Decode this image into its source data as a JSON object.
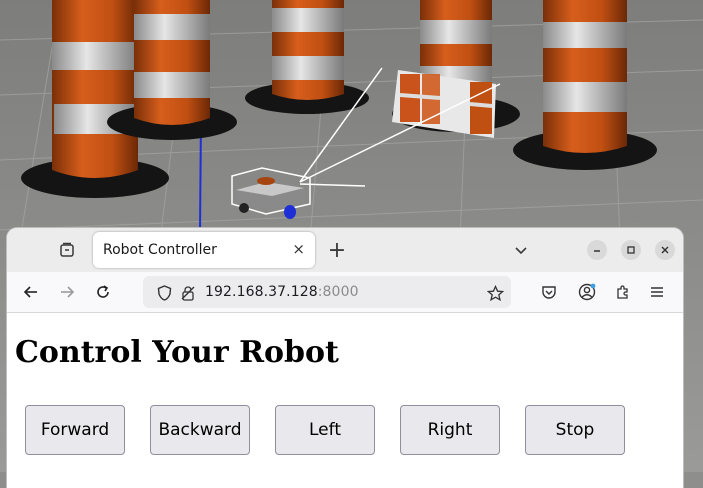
{
  "scene": {
    "description_icon": "3d-simulation-view",
    "cone_colors": {
      "orange": "#c9531a",
      "white": "#d9d9d9",
      "base": "#1a1a1a"
    },
    "floor_color": "#8f8f8d"
  },
  "browser": {
    "tab_title": "Robot Controller",
    "tab_close": "×",
    "new_tab": "+",
    "url_host": "192.168.37.128",
    "url_port": ":8000"
  },
  "page": {
    "heading": "Control Your Robot",
    "buttons": {
      "forward": "Forward",
      "backward": "Backward",
      "left": "Left",
      "right": "Right",
      "stop": "Stop"
    }
  }
}
